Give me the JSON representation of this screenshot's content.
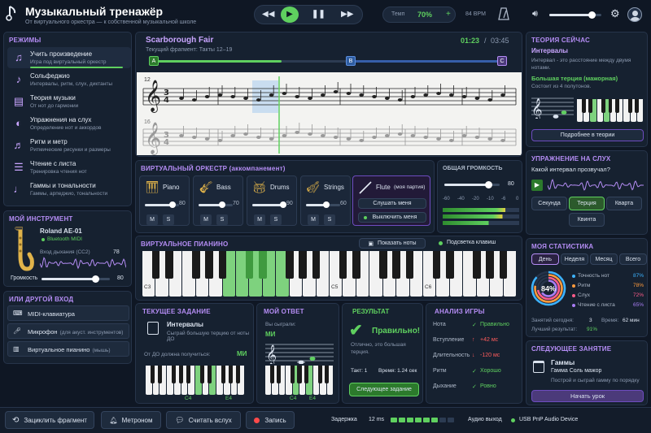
{
  "app": {
    "title": "Музыкальный тренажёр",
    "subtitle": "От виртуального оркестра — к собственной музыкальной школе"
  },
  "transport": {
    "tempo_label": "Темп",
    "tempo_value": "70%",
    "tempo_plus": "+",
    "bpm": "84 BPM",
    "volume_level": 0.82
  },
  "modes": {
    "title": "РЕЖИМЫ",
    "items": [
      {
        "title": "Учить произведение",
        "sub": "Игра под виртуальный оркестр",
        "icon": "music-note-icon"
      },
      {
        "title": "Сольфеджио",
        "sub": "Интервалы, ритм, слух, диктанты",
        "icon": "tuning-fork-icon"
      },
      {
        "title": "Теория музыки",
        "sub": "От нот до гармонии",
        "icon": "book-icon"
      },
      {
        "title": "Упражнения на слух",
        "sub": "Определение нот и аккордов",
        "icon": "ear-icon"
      },
      {
        "title": "Ритм и метр",
        "sub": "Ритмические рисунки и размеры",
        "icon": "rhythm-icon"
      },
      {
        "title": "Чтение с листа",
        "sub": "Тренировка чтения нот",
        "icon": "sheet-icon"
      },
      {
        "title": "Гаммы и тональности",
        "sub": "Гаммы, арпеджио, тональности",
        "icon": "scale-icon"
      }
    ]
  },
  "my_instrument": {
    "title": "МОЙ ИНСТРУМЕНТ",
    "name": "Roland AE-01",
    "connection": "Bluetooth MIDI",
    "breath_label": "Вход дыхания (CC2)",
    "breath_value": "78",
    "volume_label": "Громкость",
    "volume_value": "80"
  },
  "other_input": {
    "title": "ИЛИ ДРУГОЙ ВХОД",
    "items": [
      {
        "label": "MIDI-клавиатура",
        "note": ""
      },
      {
        "label": "Микрофон",
        "note": "(для акуст. инструментов)"
      },
      {
        "label": "Виртуальное пианино",
        "note": "(мышь)"
      }
    ]
  },
  "score": {
    "title": "Scarborough Fair",
    "fragment": "Текущий фрагмент: Такты 12–19",
    "time_current": "01:23",
    "time_sep": "/",
    "time_total": "03:45",
    "markers": [
      "A",
      "B",
      "C"
    ],
    "measure_top": "12",
    "measure_bottom": "16",
    "progress": 0.37
  },
  "orchestra": {
    "title": "ВИРТУАЛЬНЫЙ ОРКЕСТР (аккомпанемент)",
    "instruments": [
      {
        "name": "Piano",
        "value": "80",
        "level": 0.8
      },
      {
        "name": "Bass",
        "value": "70",
        "level": 0.7
      },
      {
        "name": "Drums",
        "value": "90",
        "level": 0.9
      },
      {
        "name": "Strings",
        "value": "60",
        "level": 0.6
      }
    ],
    "mute": "M",
    "solo": "S",
    "flute_name": "Flute",
    "flute_part": "(моя партия)",
    "listen_btn": "Слушать меня",
    "off_btn": "Выключить меня"
  },
  "master": {
    "title": "ОБЩАЯ ГРОМКОСТЬ",
    "value": "80",
    "level": 0.8,
    "scale": [
      "-60",
      "-40",
      "-20",
      "-10",
      "-6",
      "0"
    ]
  },
  "piano": {
    "title": "ВИРТУАЛЬНОЕ ПИАНИНО",
    "show_notes": "Показать ноты",
    "highlight": "Подсветка клавиш",
    "labels": [
      "C3",
      "C5",
      "C6"
    ]
  },
  "task": {
    "title": "ТЕКУЩЕЕ ЗАДАНИЕ",
    "name": "Интервалы",
    "desc": "Сыграй большую терцию от ноты ДО",
    "hint_prefix": "От ДО должна получиться:",
    "hint_value": "МИ",
    "key_labels": [
      "C4",
      "E4"
    ]
  },
  "answer": {
    "title": "МОЙ ОТВЕТ",
    "played_label": "Вы сыграли:",
    "played_value": "МИ",
    "key_labels": [
      "C4",
      "E4"
    ]
  },
  "result": {
    "title": "РЕЗУЛЬТАТ",
    "status": "Правильно!",
    "text": "Отлично, это большая терция.",
    "beat": "Такт: 1",
    "time": "Время: 1.24 сек",
    "next_btn": "Следующее задание"
  },
  "analysis": {
    "title": "АНАЛИЗ ИГРЫ",
    "rows": [
      {
        "label": "Нота",
        "value": "Правильно",
        "mark": "✓",
        "color": "#5fd05f"
      },
      {
        "label": "Вступление",
        "value": "+42 мс",
        "mark": "↑",
        "color": "#ff5c5c"
      },
      {
        "label": "Длительность",
        "value": "-120 мс",
        "mark": "↓",
        "color": "#ff5c5c"
      },
      {
        "label": "Ритм",
        "value": "Хорошо",
        "mark": "✓",
        "color": "#5fd05f"
      },
      {
        "label": "Дыхание",
        "value": "Ровно",
        "mark": "✓",
        "color": "#5fd05f"
      }
    ]
  },
  "theory": {
    "title": "ТЕОРИЯ СЕЙЧАС",
    "head": "Интервалы",
    "text": "Интервал - это расстояние между двумя нотами.",
    "sub_head": "Большая терция (мажорная)",
    "sub_text": "Состоит из 4 полутонов.",
    "more_btn": "Подробнее в теории"
  },
  "ear": {
    "title": "УПРАЖНЕНИЕ НА СЛУХ",
    "question": "Какой интервал прозвучал?",
    "options": [
      "Секунда",
      "Терция",
      "Кварта",
      "Квинта"
    ],
    "selected": 1
  },
  "stats": {
    "title": "МОЯ СТАТИСТИКА",
    "tabs": [
      "День",
      "Неделя",
      "Месяц",
      "Всего"
    ],
    "active": 0,
    "center": "84%",
    "items": [
      {
        "label": "Точность нот",
        "value": "87%",
        "color": "#3db3ff",
        "pct": 87
      },
      {
        "label": "Ритм",
        "value": "78%",
        "color": "#ff9b3d",
        "pct": 78
      },
      {
        "label": "Слух",
        "value": "72%",
        "color": "#ff5c8a",
        "pct": 72
      },
      {
        "label": "Чтение с листа",
        "value": "65%",
        "color": "#a97df5",
        "pct": 65
      }
    ],
    "today_label": "Занятий сегодня:",
    "today_value": "3",
    "time_label": "Время:",
    "time_value": "62 мин",
    "best_label": "Лучший результат:",
    "best_value": "91%"
  },
  "next_lesson": {
    "title": "СЛЕДУЮЩЕЕ ЗАНЯТИЕ",
    "head": "Гаммы",
    "sub": "Гамма Соль мажор",
    "desc": "Построй и сыграй гамму по порядку",
    "btn": "Начать урок"
  },
  "bottom": {
    "loop": "Зациклить фрагмент",
    "metronome": "Метроном",
    "count": "Считать вслух",
    "record": "Запись",
    "latency_label": "Задержка",
    "latency_value": "12 ms",
    "audio_label": "Аудио выход",
    "audio_device": "USB PnP Audio Device"
  },
  "colors": {
    "accent": "#b58df5",
    "green": "#5fd05f",
    "bg": "#0f1724",
    "panel": "#162130"
  }
}
